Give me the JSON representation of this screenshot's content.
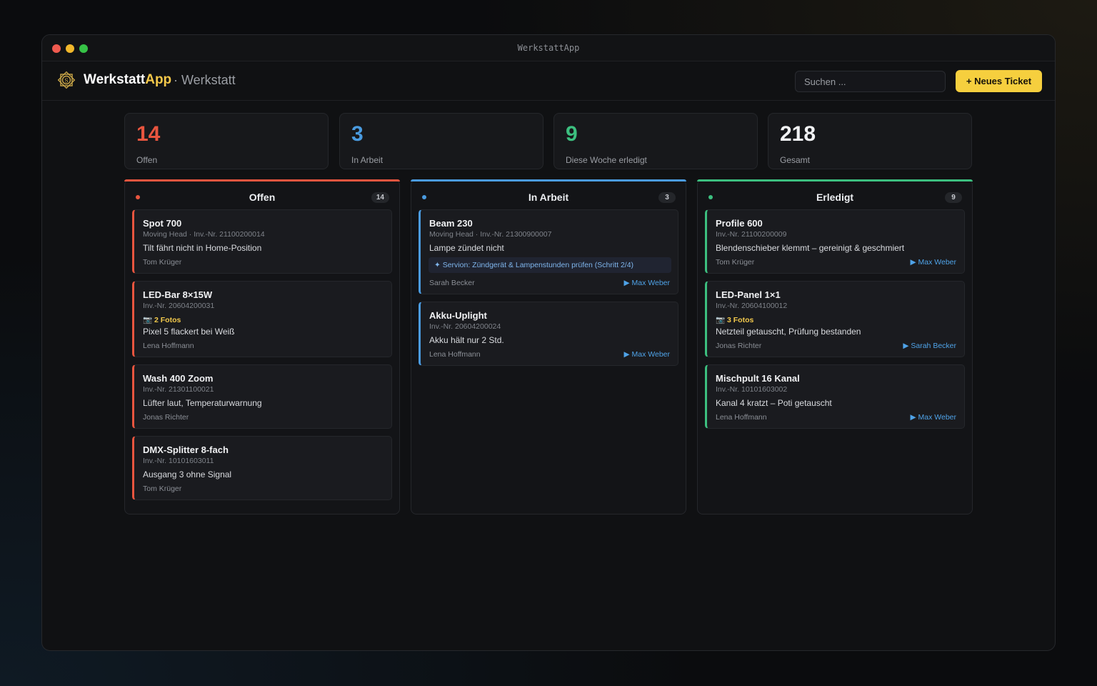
{
  "window": {
    "title": "WerkstattApp"
  },
  "header": {
    "brand_primary": "Werkstatt",
    "brand_accent": "App",
    "section": "· Werkstatt",
    "search_placeholder": "Suchen ...",
    "new_ticket_label": "+ Neues Ticket"
  },
  "colors": {
    "open": "#e8553f",
    "in_progress": "#4a9be0",
    "done": "#3cbf7f",
    "accent": "#f6cf3e"
  },
  "stats": [
    {
      "value": "14",
      "label": "Offen"
    },
    {
      "value": "3",
      "label": "In Arbeit"
    },
    {
      "value": "9",
      "label": "Diese Woche erledigt"
    },
    {
      "value": "218",
      "label": "Gesamt"
    }
  ],
  "columns": [
    {
      "title": "Offen",
      "count": "14",
      "cards": [
        {
          "title": "Spot 700",
          "meta": "Moving Head · Inv.-Nr. 21100200014",
          "desc": "Tilt fährt nicht in Home-Position",
          "person": "Tom Krüger"
        },
        {
          "title": "LED-Bar 8×15W",
          "meta": "Inv.-Nr. 20604200031",
          "photos": "📷 2 Fotos",
          "desc": "Pixel 5 flackert bei Weiß",
          "person": "Lena Hoffmann"
        },
        {
          "title": "Wash 400 Zoom",
          "meta": "Inv.-Nr. 21301100021",
          "desc": "Lüfter laut, Temperaturwarnung",
          "person": "Jonas Richter"
        },
        {
          "title": "DMX-Splitter 8-fach",
          "meta": "Inv.-Nr. 10101603011",
          "desc": "Ausgang 3 ohne Signal",
          "person": "Tom Krüger"
        }
      ]
    },
    {
      "title": "In Arbeit",
      "count": "3",
      "cards": [
        {
          "title": "Beam 230",
          "meta": "Moving Head · Inv.-Nr. 21300900007",
          "desc": "Lampe zündet nicht",
          "tip": "✦ Servion: Zündgerät & Lampenstunden prüfen (Schritt 2/4)",
          "person": "Sarah Becker",
          "assignee": "▶ Max Weber"
        },
        {
          "title": "Akku-Uplight",
          "meta": "Inv.-Nr. 20604200024",
          "desc": "Akku hält nur 2 Std.",
          "person": "Lena Hoffmann",
          "assignee": "▶ Max Weber"
        }
      ]
    },
    {
      "title": "Erledigt",
      "count": "9",
      "cards": [
        {
          "title": "Profile 600",
          "meta": "Inv.-Nr. 21100200009",
          "desc": "Blendenschieber klemmt – gereinigt & geschmiert",
          "person": "Tom Krüger",
          "assignee": "▶ Max Weber"
        },
        {
          "title": "LED-Panel 1×1",
          "meta": "Inv.-Nr. 20604100012",
          "photos": "📷 3 Fotos",
          "desc": "Netzteil getauscht, Prüfung bestanden",
          "person": "Jonas Richter",
          "assignee": "▶ Sarah Becker"
        },
        {
          "title": "Mischpult 16 Kanal",
          "meta": "Inv.-Nr. 10101603002",
          "desc": "Kanal 4 kratzt – Poti getauscht",
          "person": "Lena Hoffmann",
          "assignee": "▶ Max Weber"
        }
      ]
    }
  ]
}
